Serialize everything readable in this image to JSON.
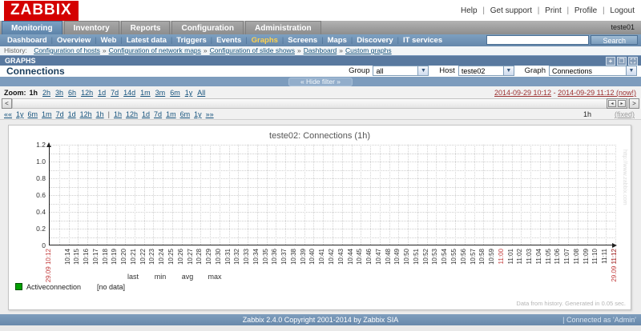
{
  "header": {
    "logo": "ZABBIX",
    "links": [
      "Help",
      "Get support",
      "Print",
      "Profile",
      "Logout"
    ],
    "link_separator": "|",
    "user": "teste01"
  },
  "main_menu": {
    "items": [
      {
        "label": "Monitoring",
        "active": true
      },
      {
        "label": "Inventory",
        "active": false
      },
      {
        "label": "Reports",
        "active": false
      },
      {
        "label": "Configuration",
        "active": false
      },
      {
        "label": "Administration",
        "active": false
      }
    ]
  },
  "sub_menu": {
    "items": [
      "Dashboard",
      "Overview",
      "Web",
      "Latest data",
      "Triggers",
      "Events",
      "Graphs",
      "Screens",
      "Maps",
      "Discovery",
      "IT services"
    ],
    "active": "Graphs",
    "separator": "|",
    "search_placeholder": "",
    "search_button": "Search"
  },
  "history": {
    "label": "History:",
    "separator": "»",
    "items": [
      "Configuration of hosts",
      "Configuration of network maps",
      "Configuration of slide shows",
      "Dashboard",
      "Custom graphs"
    ]
  },
  "page": {
    "section_title": "GRAPHS",
    "title": "Connections",
    "icons": [
      {
        "name": "add-favourite-icon",
        "glyph": "+"
      },
      {
        "name": "reset-icon",
        "glyph": "❐"
      },
      {
        "name": "fullscreen-icon",
        "glyph": "⛶"
      }
    ]
  },
  "filter_bar": {
    "hide_filter": "« Hide filter »",
    "group_label": "Group",
    "group_value": "all",
    "host_label": "Host",
    "host_value": "teste02",
    "graph_label": "Graph",
    "graph_value": "Connections",
    "dropdown_arrow": "▼"
  },
  "timebar": {
    "zoom_label": "Zoom:",
    "zoom_options": [
      "1h",
      "2h",
      "3h",
      "6h",
      "12h",
      "1d",
      "7d",
      "14d",
      "1m",
      "3m",
      "6m",
      "1y",
      "All"
    ],
    "zoom_active": "1h",
    "period_from": "2014-09-29 10:12",
    "period_separator": "-",
    "period_to": "2014-09-29 11:12 (now!)",
    "nav_left": [
      "««",
      "1y",
      "6m",
      "1m",
      "7d",
      "1d",
      "12h",
      "1h"
    ],
    "nav_separator": "|",
    "nav_right": [
      "1h",
      "12h",
      "1d",
      "7d",
      "1m",
      "6m",
      "1y",
      "»»"
    ],
    "span_label": "1h",
    "fixed_label": "(fixed)",
    "scroll_left_glyph": "<",
    "scroll_right_glyph": ">",
    "grip_left_glyph": "◂",
    "grip_right_glyph": "▸"
  },
  "chart_data": {
    "type": "line",
    "title": "teste02: Connections (1h)",
    "xlabel": "",
    "ylabel": "",
    "ylim": [
      0,
      1.2
    ],
    "yticks": [
      "1.2",
      "1.0",
      "0.8",
      "0.6",
      "0.4",
      "0.2",
      "0"
    ],
    "grid": true,
    "x_range_minutes": 60,
    "x_start_label": "29.09 10:12",
    "x_end_label": "29.09 11:12",
    "xticks": [
      "10:14",
      "10:15",
      "10:16",
      "10:17",
      "10:18",
      "10:19",
      "10:20",
      "10:21",
      "10:22",
      "10:23",
      "10:24",
      "10:25",
      "10:26",
      "10:27",
      "10:28",
      "10:29",
      "10:30",
      "10:31",
      "10:32",
      "10:33",
      "10:34",
      "10:35",
      "10:36",
      "10:37",
      "10:38",
      "10:39",
      "10:40",
      "10:41",
      "10:42",
      "10:43",
      "10:44",
      "10:45",
      "10:46",
      "10:47",
      "10:48",
      "10:49",
      "10:50",
      "10:51",
      "10:52",
      "10:53",
      "10:54",
      "10:55",
      "10:56",
      "10:57",
      "10:58",
      "10:59",
      "11:00",
      "11:01",
      "11:02",
      "11:03",
      "11:04",
      "11:05",
      "11:06",
      "11:07",
      "11:08",
      "11:09",
      "11:10",
      "11:11",
      "11:12"
    ],
    "xticks_red": [
      "11:00"
    ],
    "series": [
      {
        "name": "Activeconnection",
        "color": "#00A000",
        "status": "[no data]",
        "values": []
      }
    ],
    "legend_columns": [
      "last",
      "min",
      "avg",
      "max"
    ],
    "legend_position": "bottom",
    "footer_note": "Data from history. Generated in 0.05 sec.",
    "watermark": "http://www.zabbix.com"
  },
  "footer": {
    "copyright": "Zabbix 2.4.0 Copyright 2001-2014 by Zabbix SIA",
    "separator": "|",
    "connected": "Connected as 'Admin'"
  }
}
